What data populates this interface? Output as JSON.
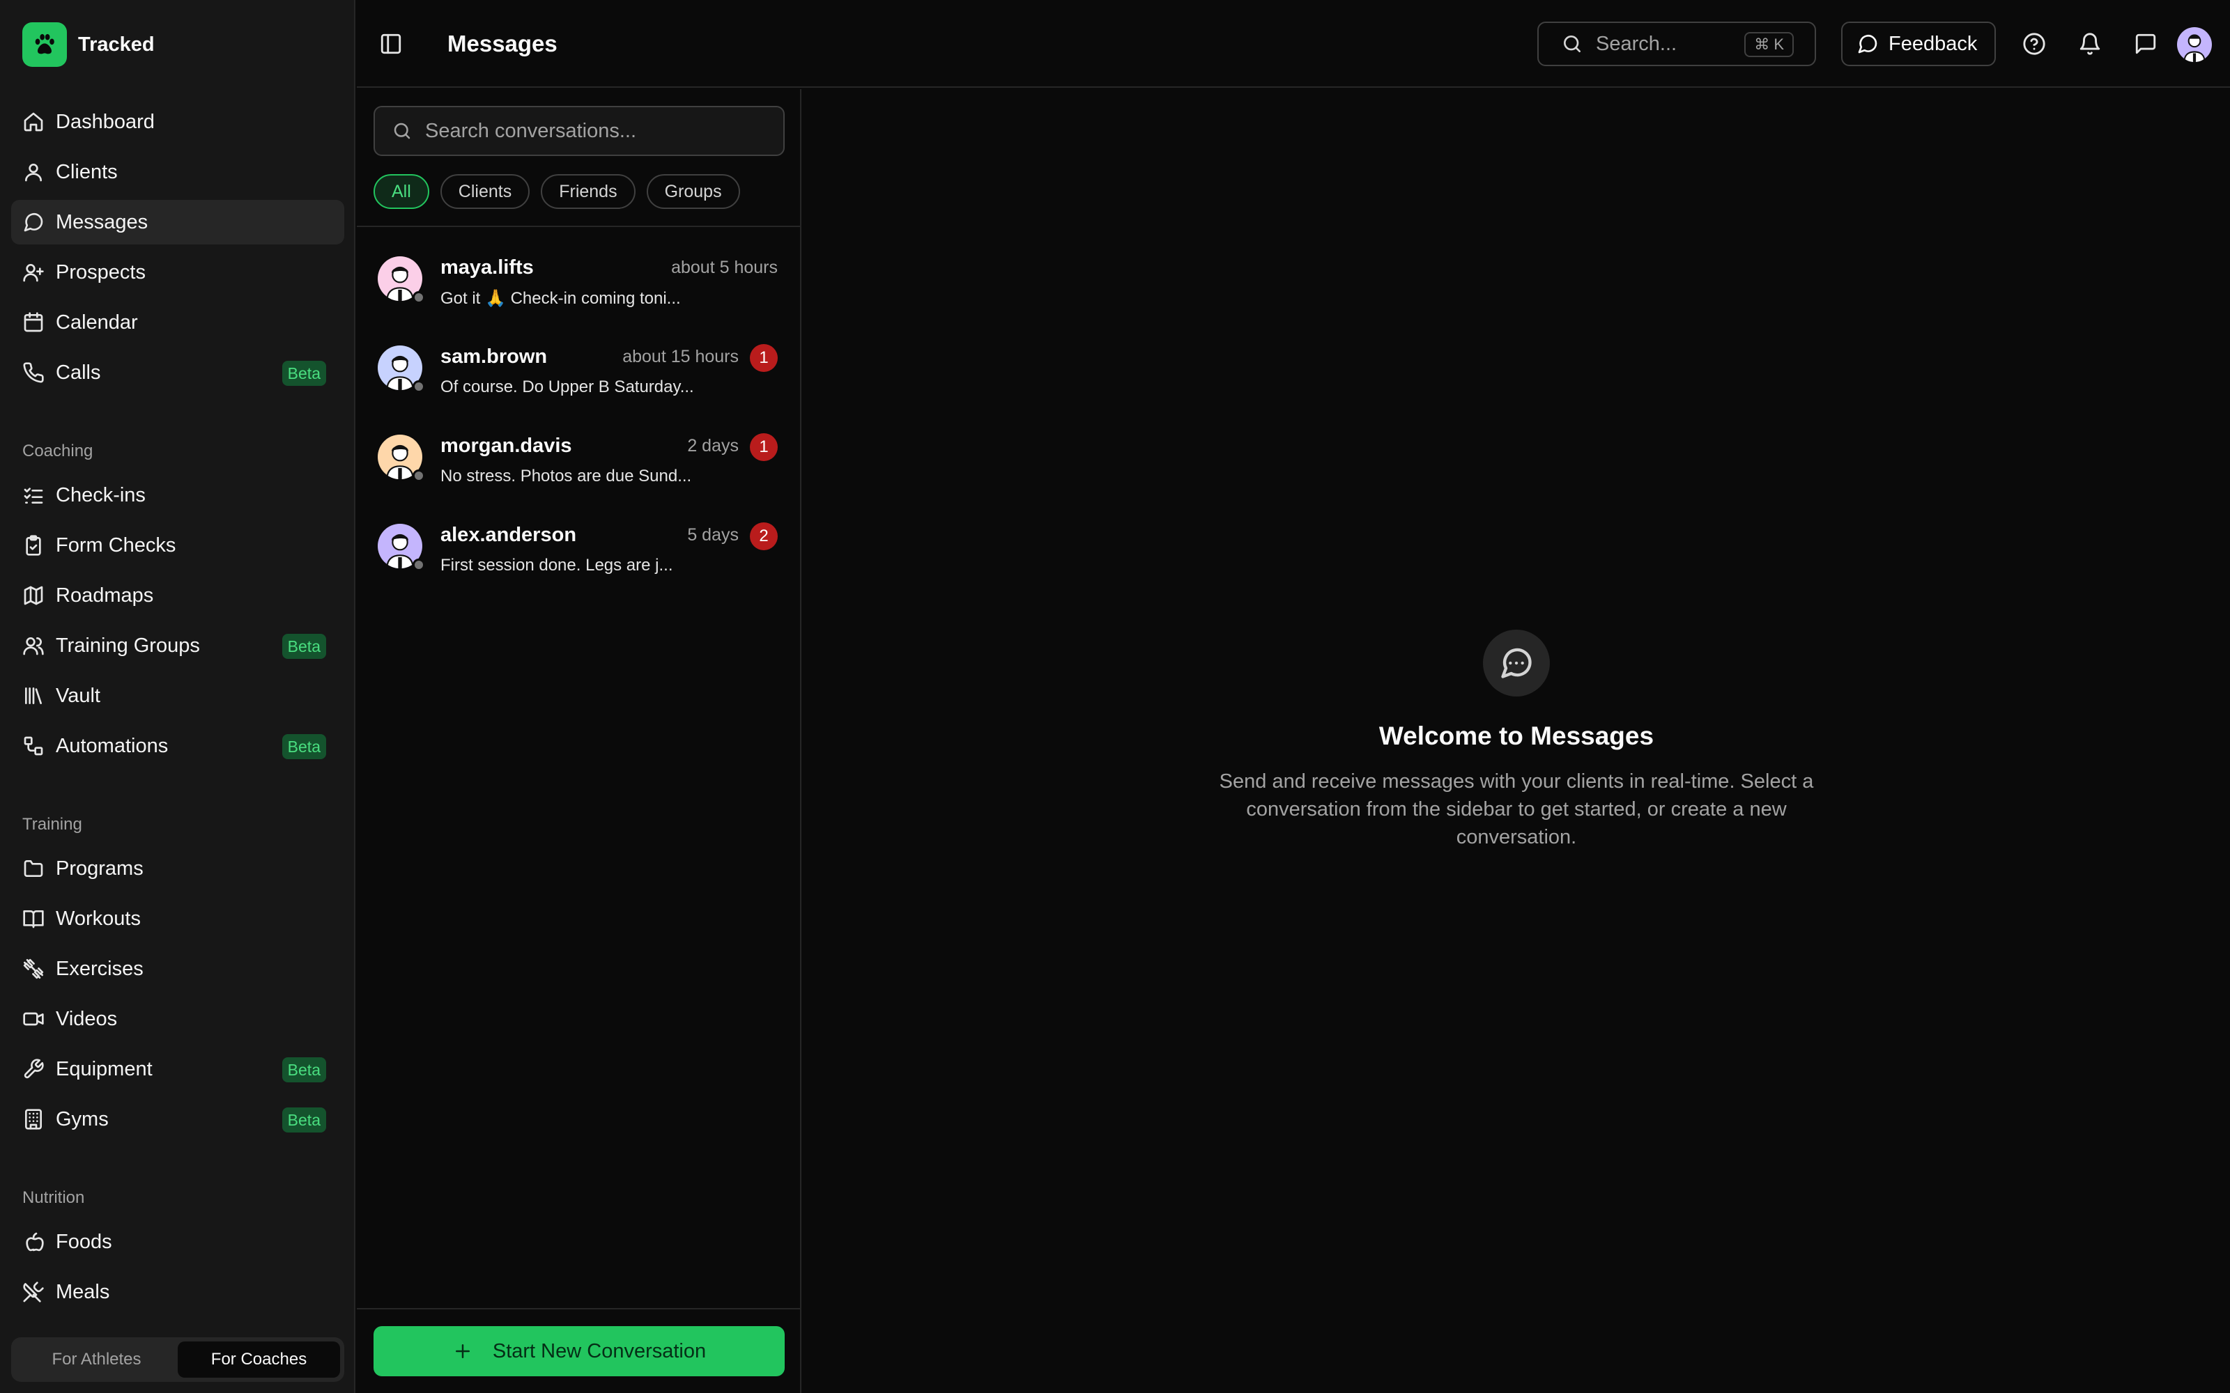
{
  "brand": {
    "name": "Tracked",
    "accent": "#22c55e"
  },
  "nav": {
    "main": [
      {
        "id": "dashboard",
        "label": "Dashboard",
        "icon": "home-icon"
      },
      {
        "id": "clients",
        "label": "Clients",
        "icon": "user-icon"
      },
      {
        "id": "messages",
        "label": "Messages",
        "icon": "message-circle-icon",
        "active": true
      },
      {
        "id": "prospects",
        "label": "Prospects",
        "icon": "user-plus-icon"
      },
      {
        "id": "calendar",
        "label": "Calendar",
        "icon": "calendar-icon"
      },
      {
        "id": "calls",
        "label": "Calls",
        "icon": "phone-icon",
        "badge": "Beta"
      }
    ],
    "coaching_label": "Coaching",
    "coaching": [
      {
        "id": "check-ins",
        "label": "Check-ins",
        "icon": "list-checks-icon"
      },
      {
        "id": "form-checks",
        "label": "Form Checks",
        "icon": "clipboard-check-icon"
      },
      {
        "id": "roadmaps",
        "label": "Roadmaps",
        "icon": "map-icon"
      },
      {
        "id": "training-groups",
        "label": "Training Groups",
        "icon": "users-icon",
        "badge": "Beta"
      },
      {
        "id": "vault",
        "label": "Vault",
        "icon": "library-icon"
      },
      {
        "id": "automations",
        "label": "Automations",
        "icon": "workflow-icon",
        "badge": "Beta"
      }
    ],
    "training_label": "Training",
    "training": [
      {
        "id": "programs",
        "label": "Programs",
        "icon": "folder-icon"
      },
      {
        "id": "workouts",
        "label": "Workouts",
        "icon": "book-open-icon"
      },
      {
        "id": "exercises",
        "label": "Exercises",
        "icon": "dumbbell-icon"
      },
      {
        "id": "videos",
        "label": "Videos",
        "icon": "video-icon"
      },
      {
        "id": "equipment",
        "label": "Equipment",
        "icon": "wrench-icon",
        "badge": "Beta"
      },
      {
        "id": "gyms",
        "label": "Gyms",
        "icon": "building-icon",
        "badge": "Beta"
      }
    ],
    "nutrition_label": "Nutrition",
    "nutrition": [
      {
        "id": "foods",
        "label": "Foods",
        "icon": "apple-icon"
      },
      {
        "id": "meals",
        "label": "Meals",
        "icon": "utensils-icon"
      }
    ],
    "audience": {
      "athletes": "For Athletes",
      "coaches": "For Coaches",
      "selected": "coaches"
    }
  },
  "header": {
    "title": "Messages",
    "search_placeholder": "Search...",
    "shortcut": "⌘ K",
    "feedback_label": "Feedback"
  },
  "conversations": {
    "search_placeholder": "Search conversations...",
    "filters": [
      {
        "label": "All",
        "selected": true
      },
      {
        "label": "Clients"
      },
      {
        "label": "Friends"
      },
      {
        "label": "Groups"
      }
    ],
    "items": [
      {
        "name": "maya.lifts",
        "time": "about 5 hours",
        "preview": "Got it 🙏 Check-in coming toni...",
        "unread": "",
        "avatar_color": "#fbcfe8"
      },
      {
        "name": "sam.brown",
        "time": "about 15 hours",
        "preview": "Of course. Do Upper B Saturday...",
        "unread": "1",
        "avatar_color": "#c7d2fe"
      },
      {
        "name": "morgan.davis",
        "time": "2 days",
        "preview": "No stress. Photos are due Sund...",
        "unread": "1",
        "avatar_color": "#fed7aa"
      },
      {
        "name": "alex.anderson",
        "time": "5 days",
        "preview": "First session done. Legs are j...",
        "unread": "2",
        "avatar_color": "#c4b5fd"
      }
    ],
    "new_button": "Start New Conversation"
  },
  "empty_state": {
    "title": "Welcome to Messages",
    "text": "Send and receive messages with your clients in real-time. Select a conversation from the sidebar to get started, or create a new conversation."
  }
}
